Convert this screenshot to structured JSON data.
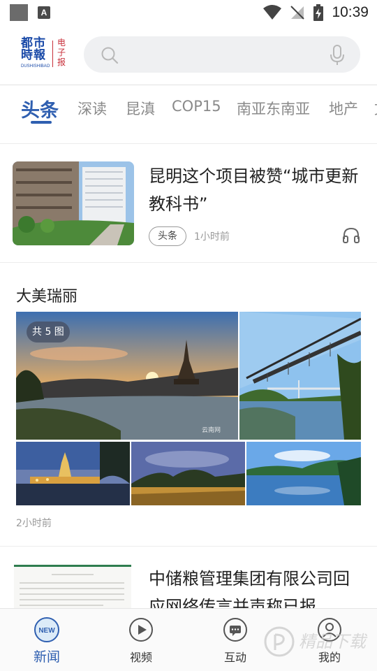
{
  "status_bar": {
    "time": "10:39",
    "notification_icon": "A"
  },
  "header": {
    "logo": {
      "main_text": "都市時報",
      "side_text": "电子报",
      "sub_text": "DUSHISHIBAO"
    },
    "search": {
      "placeholder": ""
    }
  },
  "tabs": [
    {
      "label": "头条",
      "active": true
    },
    {
      "label": "深读"
    },
    {
      "label": "昆滇"
    },
    {
      "label": "COP15"
    },
    {
      "label": "南亚东南亚"
    },
    {
      "label": "地产"
    },
    {
      "label": "文"
    }
  ],
  "articles": [
    {
      "title": "昆明这个项目被赞“城市更新教科书”",
      "tag": "头条",
      "time": "1小时前"
    }
  ],
  "gallery": {
    "title": "大美瑞丽",
    "count_badge": "共 5 图",
    "time": "2小时前",
    "watermark": "云南网"
  },
  "article3": {
    "title": "中储粮管理集团有限公司回应网络传言并声称已报"
  },
  "bottom_nav": [
    {
      "label": "新闻",
      "active": true,
      "icon": "news-icon",
      "icon_text": "NEW"
    },
    {
      "label": "视频",
      "icon": "video-icon"
    },
    {
      "label": "互动",
      "icon": "chat-icon"
    },
    {
      "label": "我的",
      "icon": "profile-icon"
    }
  ],
  "watermark_app": {
    "text": "精品下载"
  },
  "colors": {
    "accent": "#2f5fb0",
    "logo_blue": "#1a4aa8",
    "logo_red": "#c8303a"
  }
}
